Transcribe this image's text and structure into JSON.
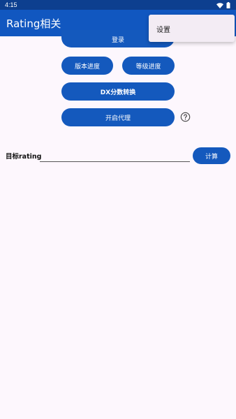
{
  "status_bar": {
    "time": "4:15",
    "wifi_icon": "wifi-icon",
    "battery_icon": "battery-icon"
  },
  "app_bar": {
    "title": "Rating相关",
    "color": "#1157c0"
  },
  "buttons": {
    "login": "登录",
    "version_progress": "版本进度",
    "level_progress": "等级进度",
    "dx_score_convert": "DX分数转换",
    "enable_proxy": "开启代理",
    "calculate": "计算"
  },
  "help_icon": "question-circle-icon",
  "target_rating": {
    "label": "目标rating",
    "value": "",
    "placeholder": ""
  },
  "overflow_menu": {
    "items": [
      "设置"
    ]
  },
  "colors": {
    "status_bar": "#0d3f8f",
    "button": "#1459bd",
    "background": "#fdf7fd",
    "menu_background": "#f3ecf4"
  }
}
